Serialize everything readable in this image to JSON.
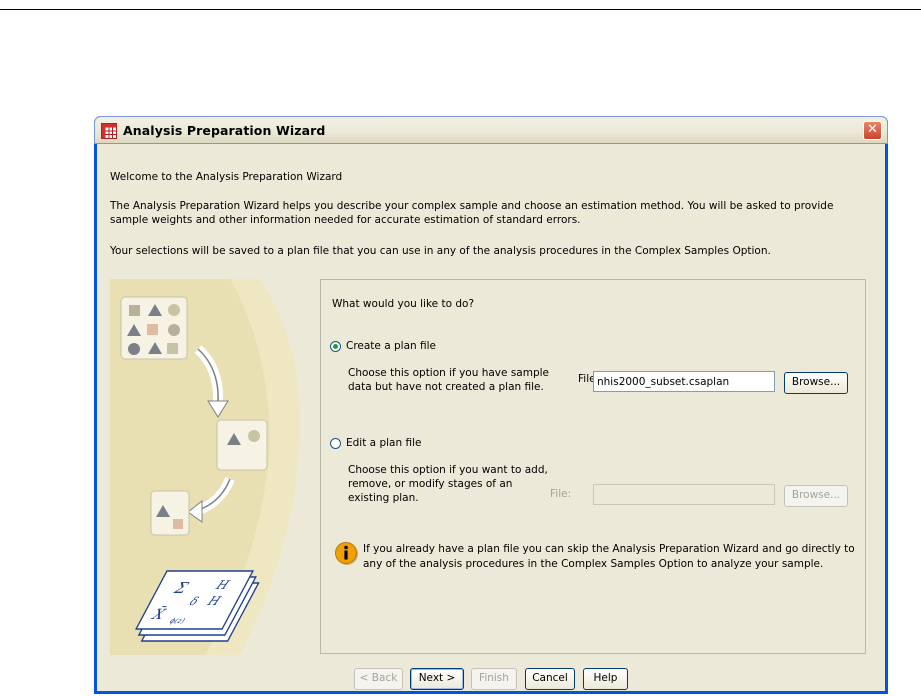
{
  "window": {
    "title": "Analysis Preparation Wizard",
    "close_glyph": "✕"
  },
  "intro": {
    "welcome": "Welcome to the Analysis Preparation Wizard",
    "description": "The Analysis Preparation Wizard helps you describe your complex sample and choose an estimation method. You will be asked to provide sample weights and other information needed for accurate estimation of standard errors.",
    "save_note": "Your selections will be saved to a plan file that you can use in any of the analysis procedures in the Complex Samples Option."
  },
  "panel": {
    "question": "What would you like to do?",
    "create": {
      "label": "Create a plan file",
      "selected": true,
      "description_line1": "Choose this option if you have sample",
      "description_line2": "data but have not created a plan file.",
      "file_label": "File:",
      "file_value": "nhis2000_subset.csaplan",
      "browse_label": "Browse..."
    },
    "edit": {
      "label": "Edit a plan file",
      "selected": false,
      "description_line1": "Choose this option if you want to add,",
      "description_line2": "remove, or modify stages of an",
      "description_line3": "existing plan.",
      "file_label": "File:",
      "file_value": "",
      "browse_label": "Browse..."
    },
    "info": "If you already have a plan file you can skip the Analysis Preparation Wizard and go directly to any of the analysis procedures in the Complex Samples Option to analyze your sample."
  },
  "buttons": {
    "back": "< Back",
    "next": "Next >",
    "finish": "Finish",
    "cancel": "Cancel",
    "help": "Help"
  },
  "icons": {
    "app": "table-grid-icon",
    "close": "close-icon",
    "info": "info-icon"
  },
  "colors": {
    "titlebar_close": "#c8452a",
    "radio_selected": "#21a121",
    "art_background": "#efe7c2",
    "info_icon": "#f0a000"
  }
}
